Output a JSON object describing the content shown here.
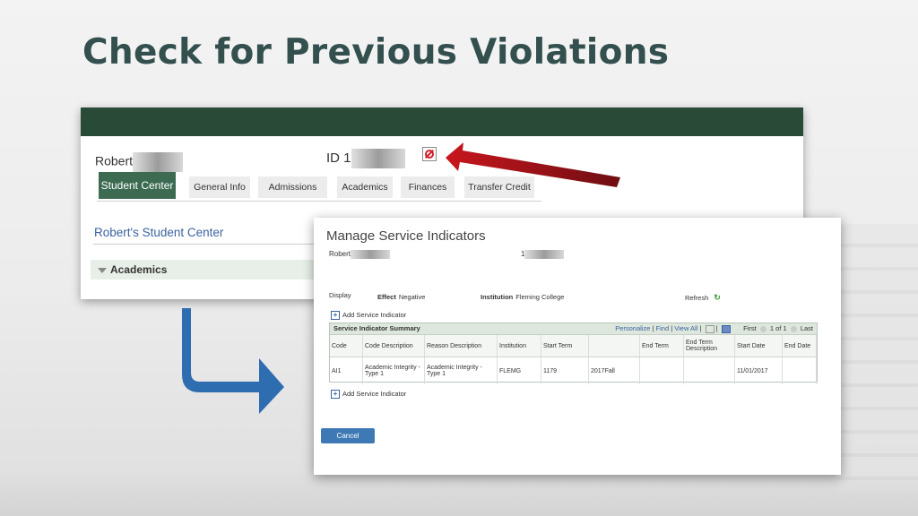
{
  "slide": {
    "title": "Check for Previous Violations"
  },
  "student_center": {
    "name_label": "Robert",
    "id_label": "ID",
    "id_prefix": "1",
    "tabs": [
      {
        "label": "Student Center",
        "active": true
      },
      {
        "label": "General Info"
      },
      {
        "label": "Admissions"
      },
      {
        "label": "Academics"
      },
      {
        "label": "Finances"
      },
      {
        "label": "Transfer Credit"
      }
    ],
    "center_link": "Robert's Student Center",
    "section": "Academics",
    "indicator_icon": "no-entry-icon"
  },
  "manage_si": {
    "title": "Manage Service Indicators",
    "name_label": "Robert",
    "id_prefix": "1",
    "display_label": "Display",
    "effect_label": "Effect",
    "effect_value": "Negative",
    "institution_label": "Institution",
    "institution_value": "Fleming College",
    "refresh_label": "Refresh",
    "add_label": "Add Service Indicator",
    "grid_title": "Service Indicator Summary",
    "nav": {
      "personalize": "Personalize",
      "find": "Find",
      "view_all": "View All",
      "first": "First",
      "range": "1 of 1",
      "last": "Last"
    },
    "columns": [
      "Code",
      "Code Description",
      "Reason Description",
      "Institution",
      "Start Term",
      "",
      "End Term",
      "End Term Description",
      "Start Date",
      "End Date"
    ],
    "rows": [
      [
        "AI1",
        "Academic Integrity - Type 1",
        "Academic Integrity - Type 1",
        "FLEMG",
        "1179",
        "2017Fall",
        "",
        "",
        "11/01/2017",
        ""
      ]
    ],
    "cancel_label": "Cancel"
  },
  "colors": {
    "title": "#33504f",
    "green_bar": "#2a4a38",
    "active_tab": "#3c6b52",
    "red_arrow": "#b81c22",
    "blue_arrow": "#2e6db0",
    "cancel": "#3e79b5"
  }
}
